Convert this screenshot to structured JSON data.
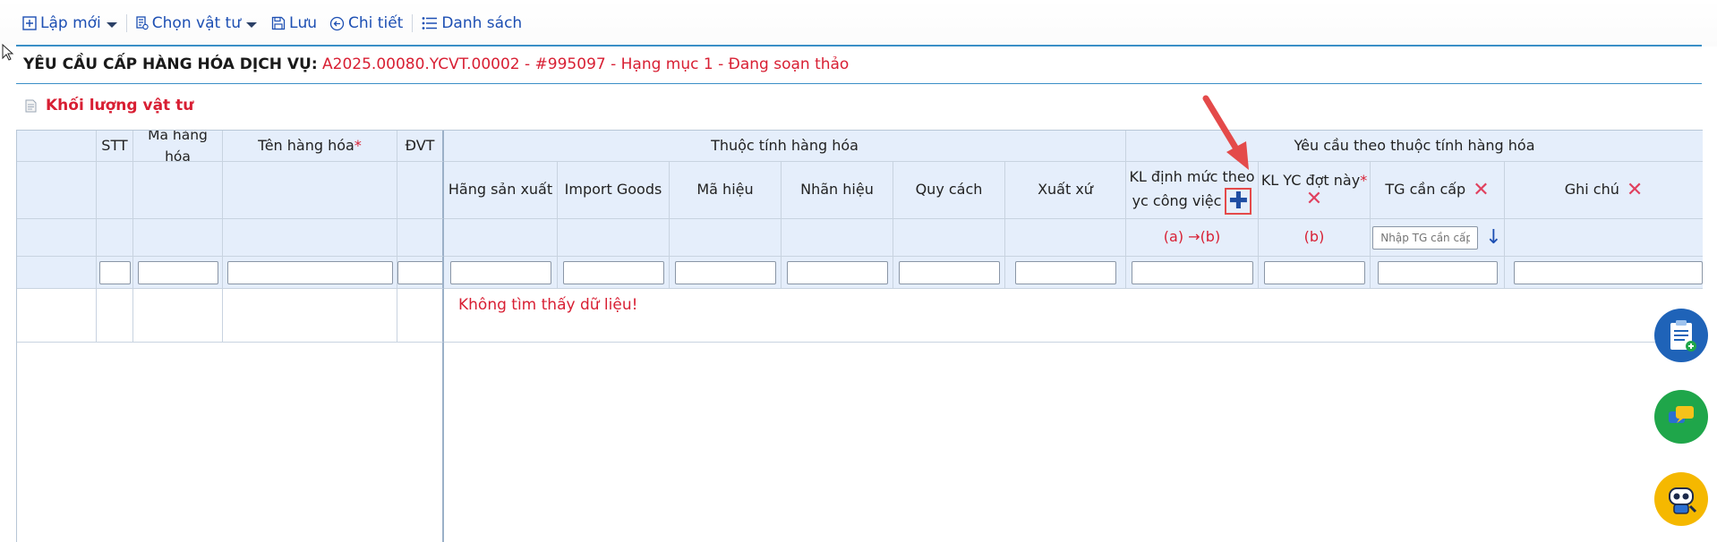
{
  "toolbar": {
    "new_label": "Lập mới",
    "choose_material_label": "Chọn vật tư",
    "save_label": "Lưu",
    "detail_label": "Chi tiết",
    "list_label": "Danh sách"
  },
  "header": {
    "label": "YÊU CẦU CẤP HÀNG HÓA DỊCH VỤ:",
    "value": "A2025.00080.YCVT.00002 - #995097 - Hạng mục 1 - Đang soạn thảo"
  },
  "section": {
    "title": "Khối lượng vật tư"
  },
  "grid": {
    "group_attrs": "Thuộc tính hàng hóa",
    "group_requirements": "Yêu cầu theo thuộc tính hàng hóa",
    "col_stt": "STT",
    "col_code": "Mã hàng hóa",
    "col_name": "Tên hàng hóa",
    "col_unit": "ĐVT",
    "required_mark": "*",
    "attr_columns": [
      "Hãng sản xuất",
      "Import Goods",
      "Mã hiệu",
      "Nhãn hiệu",
      "Quy cách",
      "Xuất xứ"
    ],
    "col_kl_dinh_muc_line1": "KL định mức theo",
    "col_kl_dinh_muc_line2": "yc công việc",
    "col_kl_yc": "KL YC đợt này",
    "col_tg": "TG cần cấp",
    "col_note": "Ghi chú",
    "formula_a_b": "(a) →(b)",
    "formula_b": "(b)",
    "tg_placeholder": "Nhập TG cần cấp",
    "empty_message": "Không tìm thấy dữ liệu!"
  },
  "icons": {
    "plus": "plus-icon",
    "close": "close-icon",
    "down_arrow": "arrow-down-icon"
  },
  "colors": {
    "accent": "#1d4fb3",
    "danger": "#d81f33",
    "header_bg": "#e5eefb",
    "fab_blue": "#1f63b8",
    "fab_green": "#1fa64a",
    "fab_yellow": "#f5b800"
  }
}
